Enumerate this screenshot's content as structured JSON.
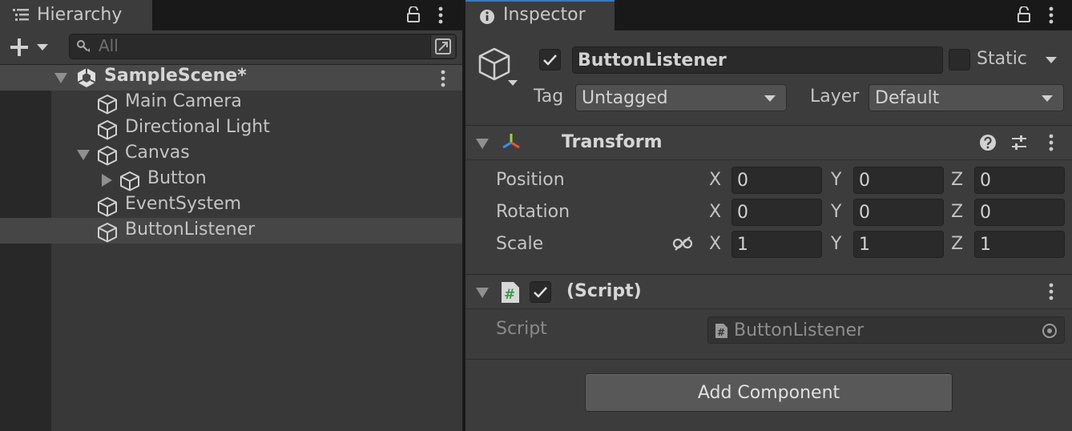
{
  "hierarchy": {
    "tab_label": "Hierarchy",
    "search_placeholder": "All",
    "scene_name": "SampleScene*",
    "items": [
      {
        "label": "Main Camera"
      },
      {
        "label": "Directional Light"
      },
      {
        "label": "Canvas"
      },
      {
        "label": "Button"
      },
      {
        "label": "EventSystem"
      },
      {
        "label": "ButtonListener"
      }
    ]
  },
  "inspector": {
    "tab_label": "Inspector",
    "object_name": "ButtonListener",
    "active": true,
    "static_label": "Static",
    "tag_label": "Tag",
    "tag_value": "Untagged",
    "layer_label": "Layer",
    "layer_value": "Default",
    "transform": {
      "title": "Transform",
      "rows": [
        {
          "label": "Position",
          "x": "0",
          "y": "0",
          "z": "0"
        },
        {
          "label": "Rotation",
          "x": "0",
          "y": "0",
          "z": "0"
        },
        {
          "label": "Scale",
          "x": "1",
          "y": "1",
          "z": "1"
        }
      ],
      "axis_x": "X",
      "axis_y": "Y",
      "axis_z": "Z"
    },
    "script_component": {
      "title": "(Script)",
      "field_label": "Script",
      "field_value": "ButtonListener"
    },
    "add_component_label": "Add Component"
  },
  "colors": {
    "transform_icon_x": "#e8543b",
    "transform_icon_y": "#9bd23c",
    "transform_icon_z": "#3b8cf0",
    "script_icon": "#3f9a4a"
  }
}
